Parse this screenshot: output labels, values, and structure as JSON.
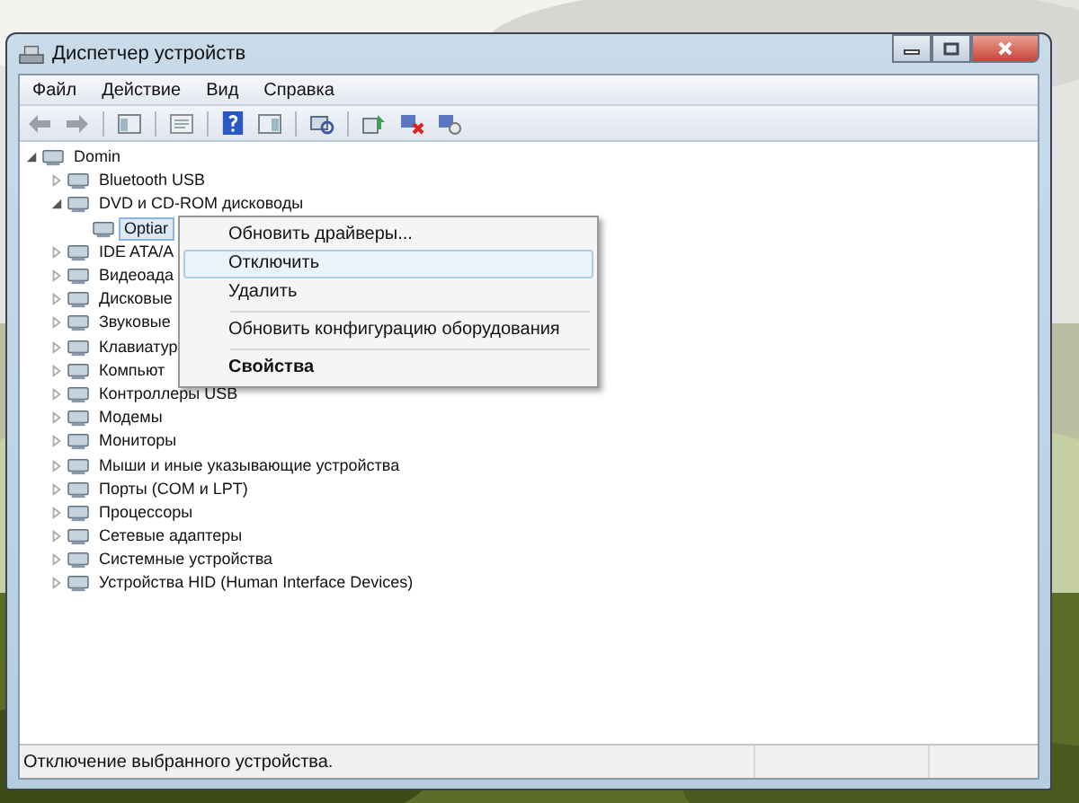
{
  "window": {
    "title": "Диспетчер устройств"
  },
  "menu_bar": [
    "Файл",
    "Действие",
    "Вид",
    "Справка"
  ],
  "tree": [
    {
      "label": "Domin",
      "expanded": true,
      "selected": false,
      "children": [
        {
          "label": "Bluetooth USB",
          "expanded": false,
          "selected": false
        },
        {
          "label": "DVD и CD-ROM дисководы",
          "expanded": true,
          "selected": false,
          "children": [
            {
              "label": "Optiar",
              "selected": true
            }
          ]
        },
        {
          "label": "IDE ATA/A",
          "expanded": false,
          "selected": false
        },
        {
          "label": "Видеоада",
          "expanded": false,
          "selected": false
        },
        {
          "label": "Дисковые",
          "expanded": false,
          "selected": false
        },
        {
          "label": "Звуковые",
          "expanded": false,
          "selected": false
        },
        {
          "label": "Клавиатур",
          "expanded": false,
          "selected": false
        },
        {
          "label": "Компьют",
          "expanded": false,
          "selected": false
        },
        {
          "label": "Контроллеры USB",
          "expanded": false,
          "selected": false
        },
        {
          "label": "Модемы",
          "expanded": false,
          "selected": false
        },
        {
          "label": "Мониторы",
          "expanded": false,
          "selected": false
        },
        {
          "label": "Мыши и иные указывающие устройства",
          "expanded": false,
          "selected": false
        },
        {
          "label": "Порты (COM и LPT)",
          "expanded": false,
          "selected": false
        },
        {
          "label": "Процессоры",
          "expanded": false,
          "selected": false
        },
        {
          "label": "Сетевые адаптеры",
          "expanded": false,
          "selected": false
        },
        {
          "label": "Системные устройства",
          "expanded": false,
          "selected": false
        },
        {
          "label": "Устройства HID (Human Interface Devices)",
          "expanded": false,
          "selected": false
        }
      ]
    }
  ],
  "context_menu": [
    {
      "kind": "item",
      "label": "Обновить драйверы...",
      "selected": false,
      "default": false
    },
    {
      "kind": "item",
      "label": "Отключить",
      "selected": true,
      "default": false
    },
    {
      "kind": "item",
      "label": "Удалить",
      "selected": false,
      "default": false
    },
    {
      "kind": "separator"
    },
    {
      "kind": "item",
      "label": "Обновить конфигурацию оборудования",
      "selected": false,
      "default": false
    },
    {
      "kind": "separator"
    },
    {
      "kind": "item",
      "label": "Свойства",
      "selected": false,
      "default": true
    }
  ],
  "status_bar": "Отключение выбранного устройства."
}
